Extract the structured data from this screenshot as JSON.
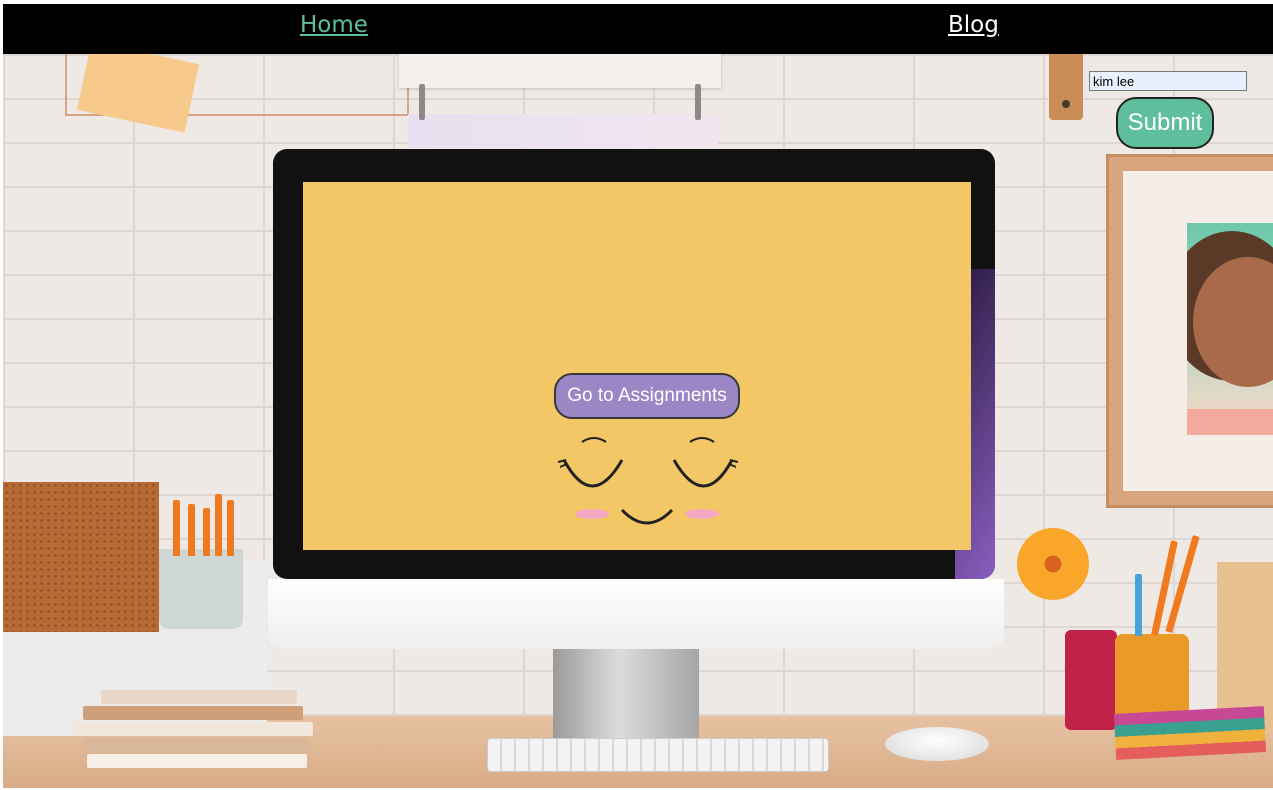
{
  "nav": {
    "home_label": "Home",
    "blog_label": "Blog",
    "home_color": "#5fbf9c",
    "blog_color": "#ffffff"
  },
  "form": {
    "name_value": "kim lee",
    "submit_label": "Submit",
    "submit_color": "#5fbf9c"
  },
  "screen": {
    "button_label": "Go to Assignments",
    "button_color": "#9b87c6",
    "screen_color": "#f4c766"
  },
  "icons": {
    "smiley": "sleepy-smiley-face-icon"
  }
}
